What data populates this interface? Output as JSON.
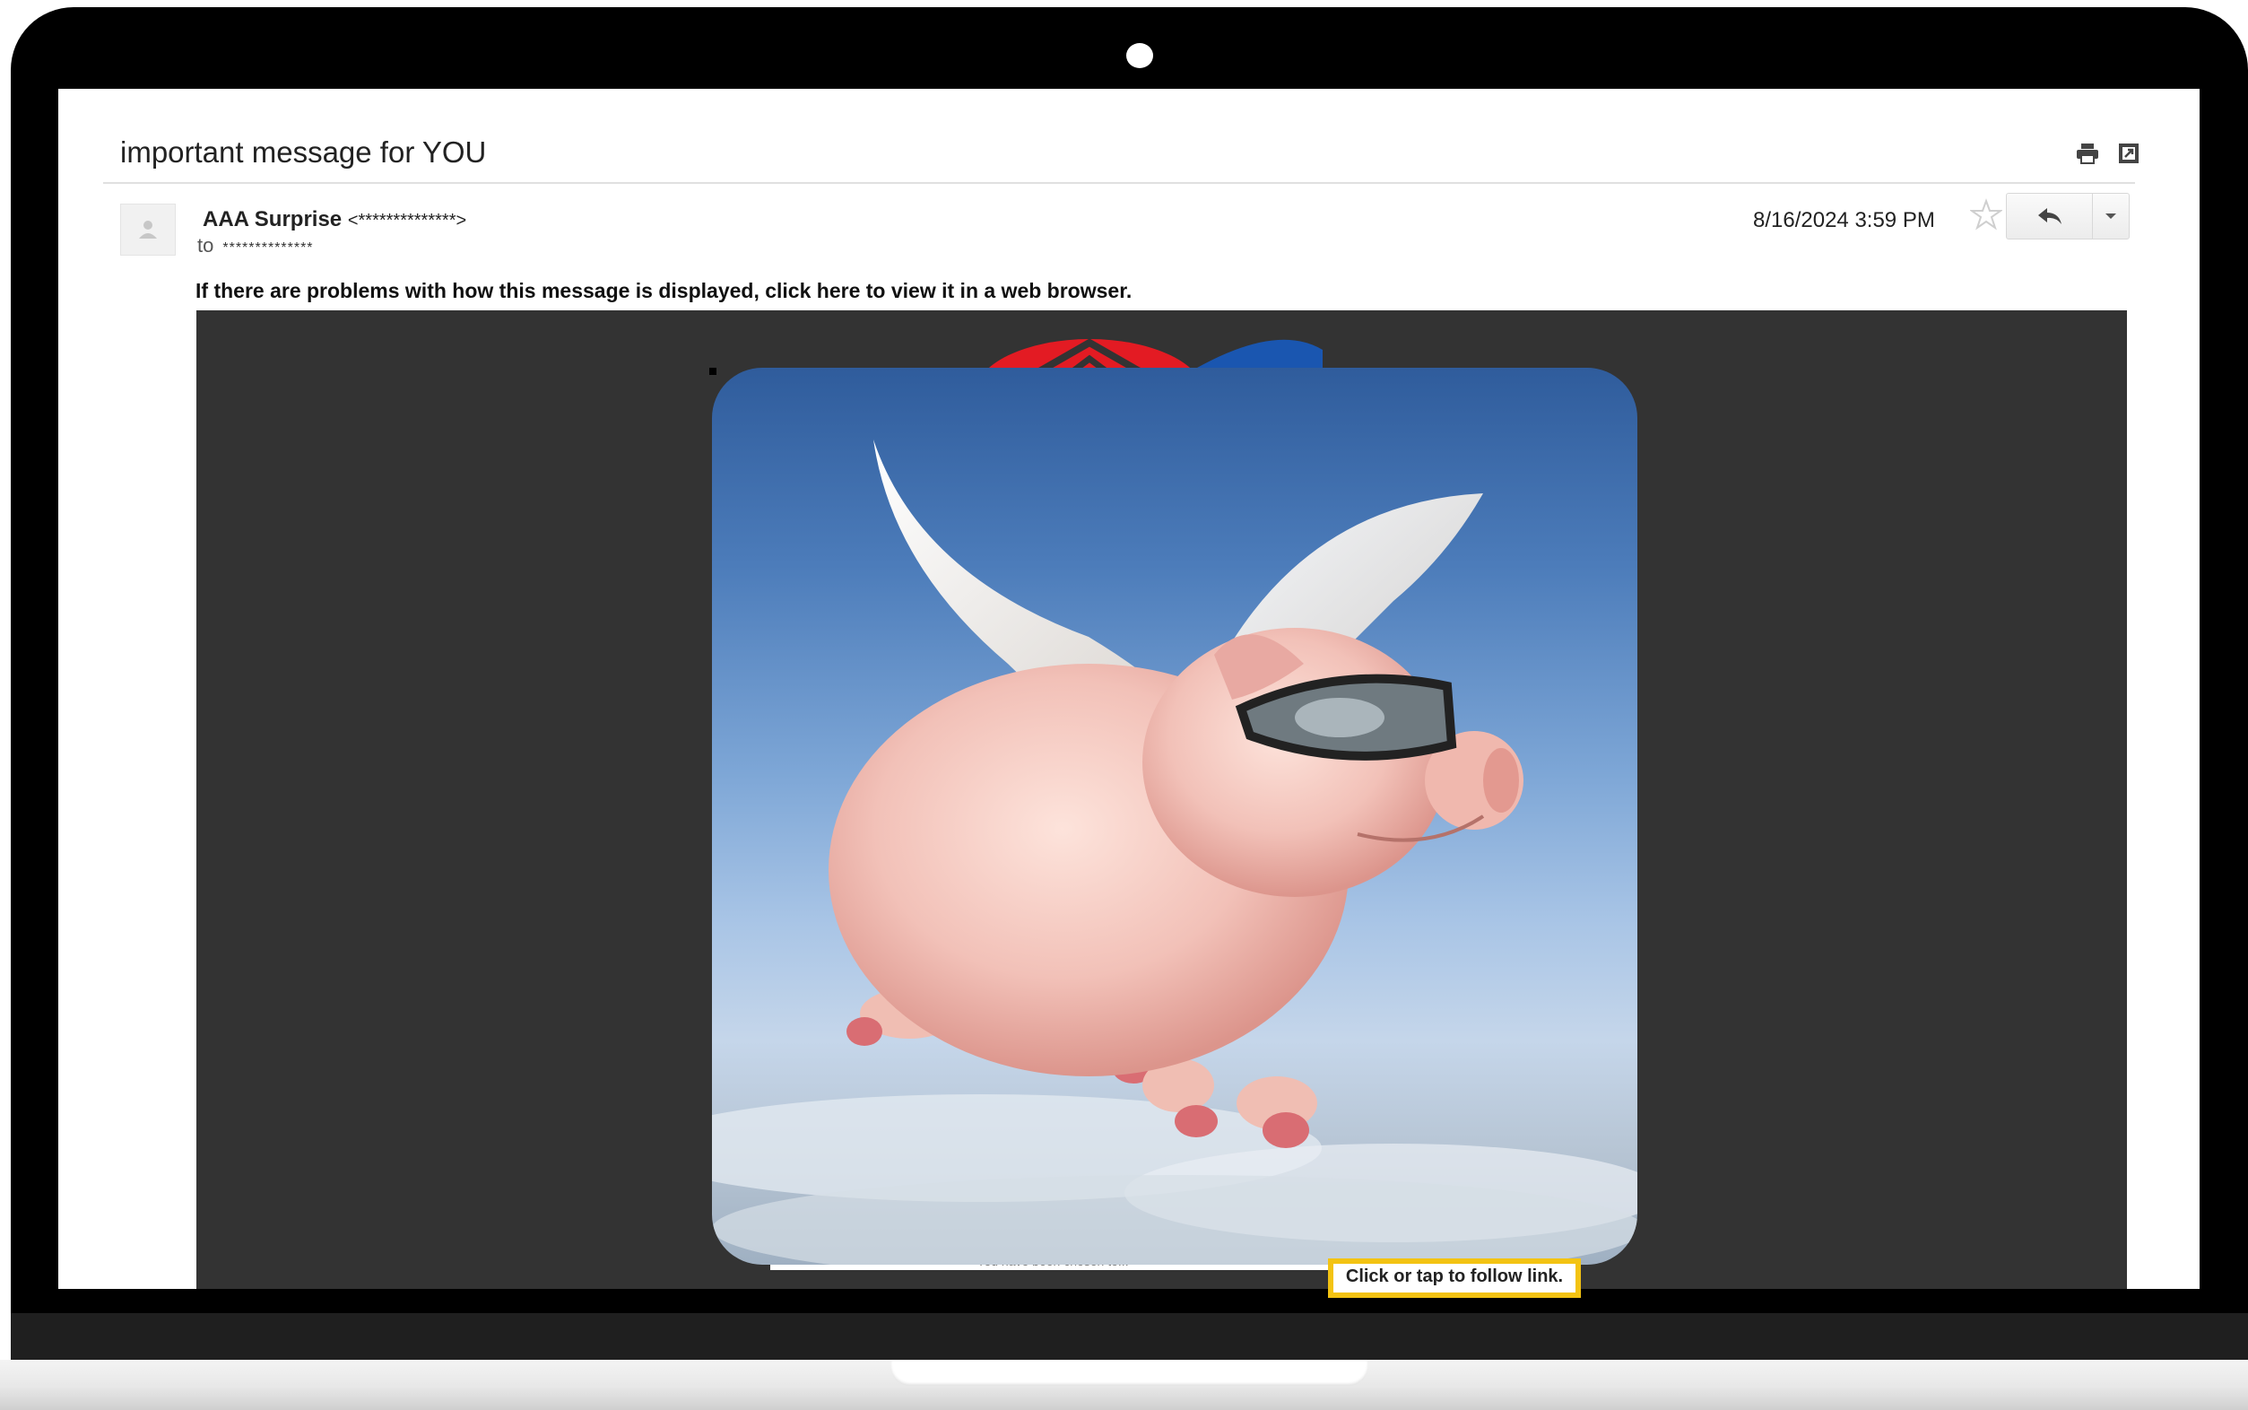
{
  "email": {
    "subject": "important message for YOU",
    "sender_name": "AAA Surprise",
    "sender_address": "<**************>",
    "to_label": "to",
    "recipient": "**************",
    "date": "8/16/2024 3:59 PM",
    "view_in_browser": "If there are problems with how this message is displayed, click here to view it in a web browser."
  },
  "toolbar": {
    "print_icon": "print-icon",
    "popout_icon": "open-in-new-window-icon",
    "star_icon": "star-icon",
    "reply_icon": "reply-icon",
    "more_icon": "chevron-down-icon"
  },
  "body": {
    "logo": "AAA logo",
    "hidden_text": "You have been chosen to...",
    "image": "flying pig with wings and goggles",
    "tooltip": "Click or tap to follow link."
  },
  "colors": {
    "body_background": "#333333",
    "tooltip_border": "#f3c312",
    "logo_red": "#e31b23",
    "logo_blue": "#1a56b0"
  }
}
